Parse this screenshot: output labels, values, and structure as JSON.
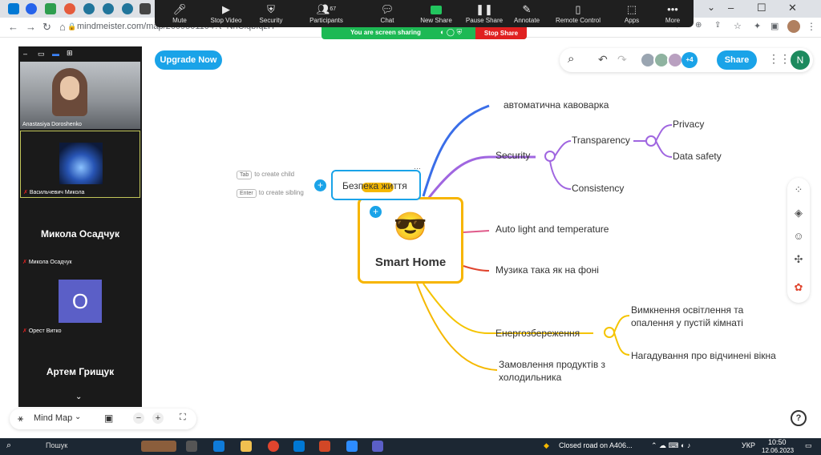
{
  "browser": {
    "url": "mindmeister.com/map/2609501104?t=NhCiqbIqzH",
    "window_controls": [
      "–",
      "☐",
      "✕"
    ]
  },
  "zoom": {
    "toolbar": [
      {
        "label": "Mute",
        "icon": "microphone-icon"
      },
      {
        "label": "Stop Video",
        "icon": "video-camera-icon"
      },
      {
        "label": "Security",
        "icon": "shield-icon"
      },
      {
        "label": "Participants",
        "icon": "people-icon",
        "count": "67"
      },
      {
        "label": "Chat",
        "icon": "chat-bubble-icon"
      },
      {
        "label": "New Share",
        "icon": "share-screen-icon"
      },
      {
        "label": "Pause Share",
        "icon": "pause-icon"
      },
      {
        "label": "Annotate",
        "icon": "pencil-icon"
      },
      {
        "label": "Remote Control",
        "icon": "mouse-icon"
      },
      {
        "label": "Apps",
        "icon": "apps-icon"
      },
      {
        "label": "More",
        "icon": "more-dots-icon"
      }
    ],
    "sharing_banner": "You are screen sharing",
    "stop_share": "Stop Share",
    "participants": [
      {
        "name": "Anastasiya Doroshenko",
        "type": "video"
      },
      {
        "name": "Васильчевич Микола",
        "type": "image"
      },
      {
        "name": "Микола Осадчук",
        "display": "Микола Осадчук",
        "type": "name"
      },
      {
        "name": "Орест Витко",
        "initial": "O",
        "type": "initial"
      },
      {
        "name": "Артем Грищук",
        "display": "Артем Грищук",
        "type": "name"
      }
    ]
  },
  "mindmeister": {
    "upgrade_label": "Upgrade Now",
    "share_label": "Share",
    "extra_collaborators": "+4",
    "user_initial": "N",
    "hints": {
      "tab_key": "Tab",
      "tab_text": "to create child",
      "enter_key": "Enter",
      "enter_text": "to create sibling"
    },
    "bottom": {
      "mode_label": "Mind Map",
      "zoom_out": "−",
      "zoom_in": "+"
    },
    "help": "?"
  },
  "map": {
    "central": "Smart Home",
    "central_emoji": "😎",
    "selected_node": "Безпека життя",
    "nodes": {
      "coffee": "автоматична кавоварка",
      "security": "Security",
      "transparency": "Transparency",
      "privacy": "Privacy",
      "data_safety": "Data safety",
      "consistency": "Consistency",
      "light": "Auto light and temperature",
      "music": "Музика така як на фоні",
      "energy": "Енергозбереження",
      "energy_off_1": "Вимкнення освітлення та",
      "energy_off_2": "опалення у пустій кімнаті",
      "windows": "Нагадування про відчинені вікна",
      "fridge_1": "Замовлення продуктів з",
      "fridge_2": "холодильника"
    },
    "colors": {
      "coffee": "#3a6ee8",
      "security": "#a066e0",
      "light": "#e05a8a",
      "music": "#e0452e",
      "energy": "#f5c400",
      "fridge": "#f5b800",
      "central": "#f7b500"
    }
  },
  "taskbar": {
    "search": "Пошук",
    "notification": "Closed road on A406...",
    "lang": "УКР",
    "time": "10:50",
    "date": "12.06.2023"
  }
}
